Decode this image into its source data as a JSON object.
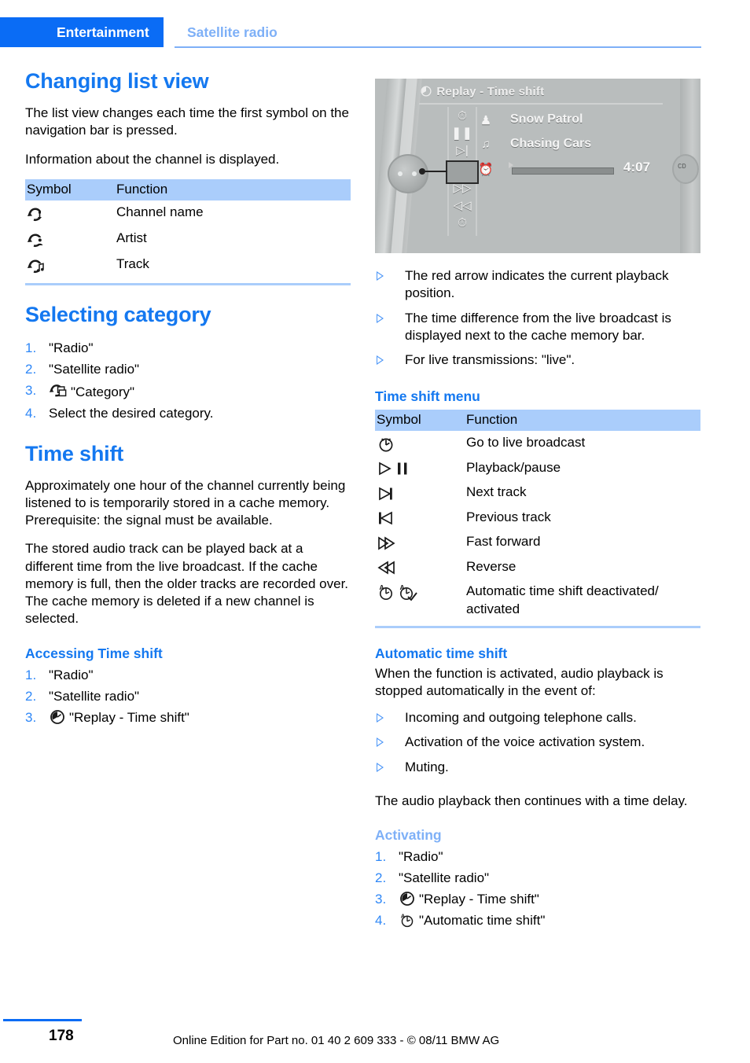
{
  "header": {
    "active_tab": "Entertainment",
    "secondary_tab": "Satellite radio"
  },
  "left_column": {
    "heading_changing_list_view": "Changing list view",
    "paragraphs": [
      "The list view changes each time the first symbol on the navigation bar is pressed.",
      "Information about the channel is displayed."
    ],
    "list_view_table": {
      "col_symbol": "Symbol",
      "col_function": "Function",
      "rows": [
        {
          "icon": "refresh-antenna-icon",
          "function": "Channel name"
        },
        {
          "icon": "refresh-artist-icon",
          "function": "Artist"
        },
        {
          "icon": "refresh-note-icon",
          "function": "Track"
        }
      ]
    },
    "heading_selecting_category": "Selecting category",
    "selecting_category_steps": [
      {
        "num": "1.",
        "text": "\"Radio\"",
        "icon": ""
      },
      {
        "num": "2.",
        "text": "\"Satellite radio\"",
        "icon": ""
      },
      {
        "num": "3.",
        "text": "\"Category\"",
        "icon": "refresh-category-icon"
      },
      {
        "num": "4.",
        "text": "Select the desired category.",
        "icon": ""
      }
    ],
    "heading_time_shift": "Time shift",
    "time_shift_paragraphs": [
      "Approximately one hour of the channel currently being listened to is temporarily stored in a cache memory. Prerequisite: the signal must be available.",
      "The stored audio track can be played back at a different time from the live broadcast. If the cache memory is full, then the older tracks are recorded over. The cache memory is deleted if a new channel is selected."
    ],
    "heading_accessing_time_shift": "Accessing Time shift",
    "accessing_steps": [
      {
        "num": "1.",
        "text": "\"Radio\"",
        "icon": ""
      },
      {
        "num": "2.",
        "text": "\"Satellite radio\"",
        "icon": ""
      },
      {
        "num": "3.",
        "text": "\"Replay - Time shift\"",
        "icon": "replay-time-shift-icon"
      }
    ]
  },
  "right_column": {
    "idrive_screenshot": {
      "title": "Replay - Time shift",
      "title_icon": "replay-time-shift-icon",
      "menu_icons": [
        "live-broadcast-icon",
        "pause-icon",
        "next-track-icon",
        "previous-track-icon",
        "fast-forward-icon",
        "reverse-icon",
        "automatic-time-shift-icon"
      ],
      "selected_menu_icon": "previous-track-icon",
      "artist_icon": "artist-icon",
      "artist": "Snow Patrol",
      "track_icon": "music-note-icon",
      "track": "Chasing Cars",
      "cache_icon": "cache-memory-icon",
      "time": "4:07",
      "right_badge": "cd-icon"
    },
    "screenshot_bullets": [
      "The red arrow indicates the current playback position.",
      "The time difference from the live broadcast is displayed next to the cache memory bar.",
      "For live transmissions: \"live\"."
    ],
    "heading_time_shift_menu": "Time shift menu",
    "time_shift_menu_table": {
      "col_symbol": "Symbol",
      "col_function": "Function",
      "rows": [
        {
          "icon": "live-broadcast-icon",
          "function": "Go to live broadcast"
        },
        {
          "icon": "play-pause-icon",
          "function": "Playback/pause"
        },
        {
          "icon": "next-track-icon",
          "function": "Next track"
        },
        {
          "icon": "previous-track-icon",
          "function": "Previous track"
        },
        {
          "icon": "fast-forward-icon",
          "function": "Fast forward"
        },
        {
          "icon": "reverse-icon",
          "function": "Reverse"
        },
        {
          "icon": "automatic-time-shift-pair-icon",
          "function": "Automatic time shift deactivated/ activated"
        }
      ]
    },
    "heading_automatic_time_shift": "Automatic time shift",
    "automatic_intro": "When the function is activated, audio playback is stopped automatically in the event of:",
    "automatic_bullets": [
      "Incoming and outgoing telephone calls.",
      "Activation of the voice activation system.",
      "Muting."
    ],
    "automatic_outro": "The audio playback then continues with a time delay.",
    "heading_activating": "Activating",
    "activating_steps": [
      {
        "num": "1.",
        "text": "\"Radio\"",
        "icon": ""
      },
      {
        "num": "2.",
        "text": "\"Satellite radio\"",
        "icon": ""
      },
      {
        "num": "3.",
        "text": "\"Replay - Time shift\"",
        "icon": "replay-time-shift-icon"
      },
      {
        "num": "4.",
        "text": "\"Automatic time shift\"",
        "icon": "automatic-time-shift-icon"
      }
    ]
  },
  "footer": {
    "page_number": "178",
    "note": "Online Edition for Part no. 01 40 2 609 333 - © 08/11 BMW AG"
  },
  "colors": {
    "accent_blue": "#0a6cf5",
    "heading_blue": "#1478f0",
    "light_blue": "#7eb0f7",
    "table_header_blue": "#aacdfb"
  }
}
